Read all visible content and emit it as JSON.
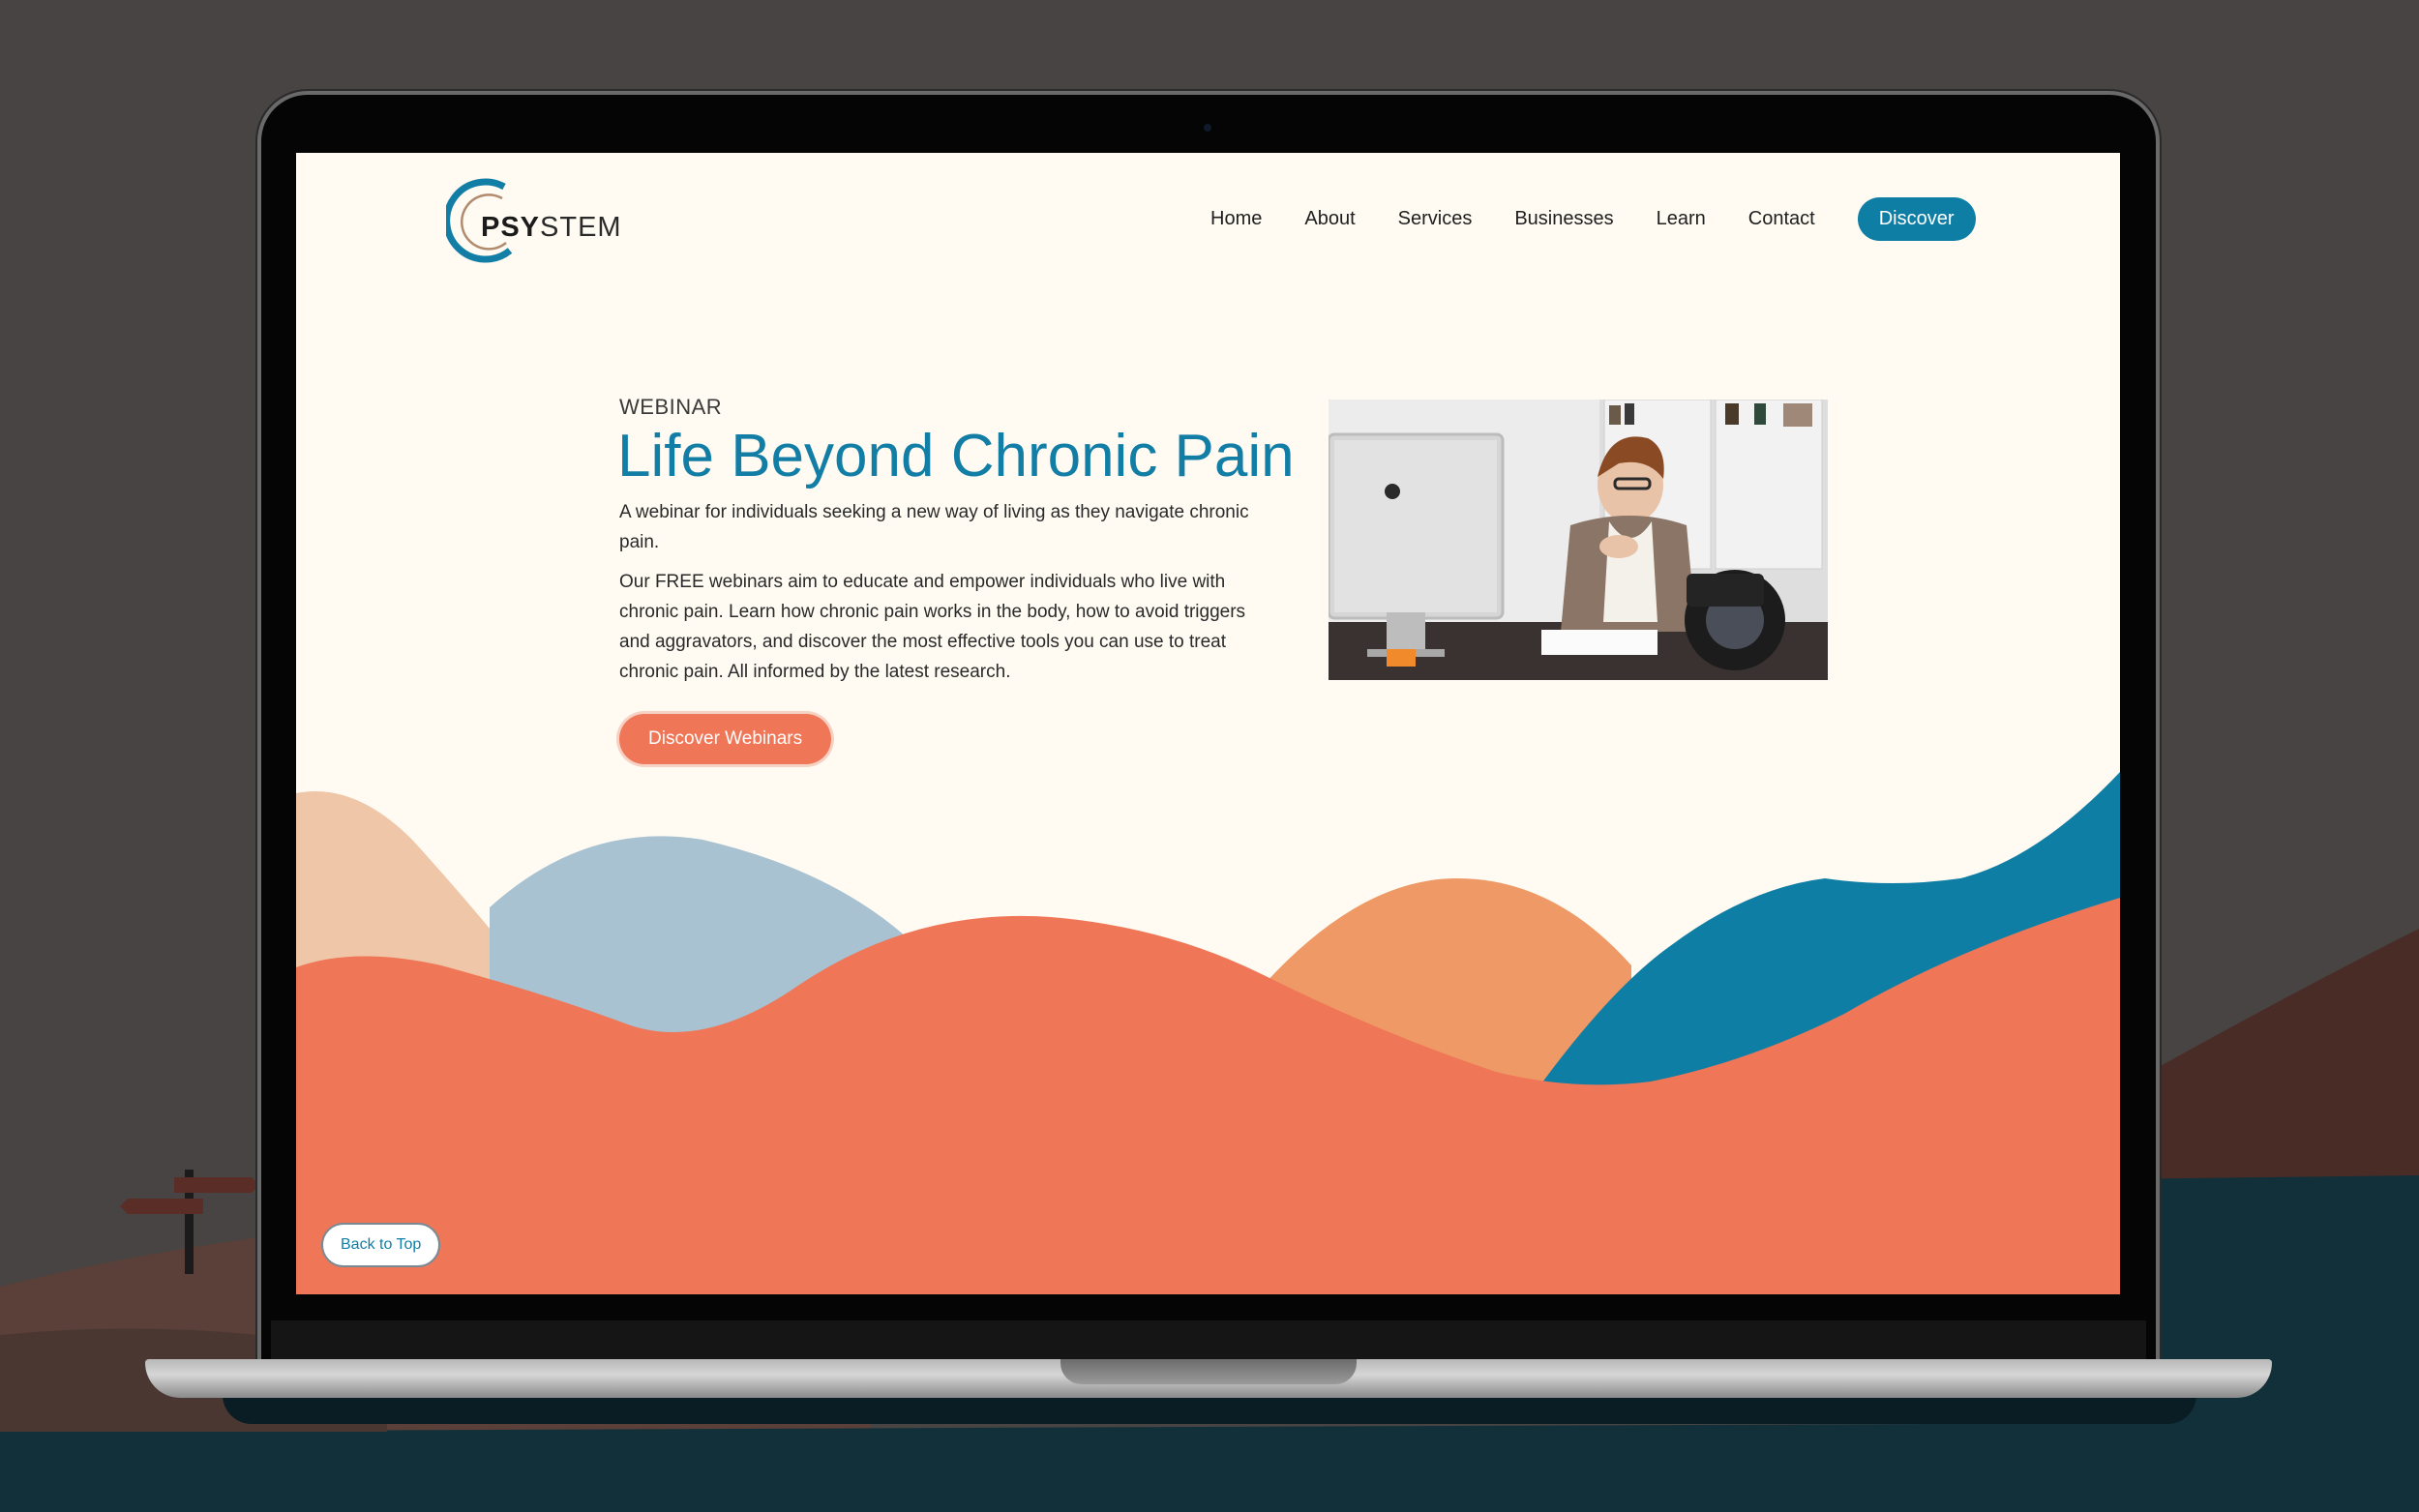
{
  "site": {
    "logo": {
      "bold": "PSY",
      "light": "STEM"
    },
    "nav": {
      "items": [
        "Home",
        "About",
        "Services",
        "Businesses",
        "Learn",
        "Contact"
      ],
      "cta_label": "Discover"
    }
  },
  "hero": {
    "eyebrow": "WEBINAR",
    "title": "Life Beyond Chronic Pain",
    "intro": "A webinar for individuals seeking a new way of living as they navigate chronic pain.",
    "body": "Our FREE webinars aim to educate and empower individuals who live with chronic pain. Learn how chronic pain works in the body, how to avoid triggers and aggravators, and discover the most effective tools you can use to treat chronic pain. All informed by the latest research.",
    "cta_label": "Discover Webinars"
  },
  "footer": {
    "back_to_top_label": "Back to Top"
  },
  "colors": {
    "brand_blue": "#127ea6",
    "coral": "#ef7656",
    "peach": "#efc6a8",
    "sky": "#a8c2d2",
    "orange": "#ee9966",
    "cream": "#fffaf2"
  }
}
